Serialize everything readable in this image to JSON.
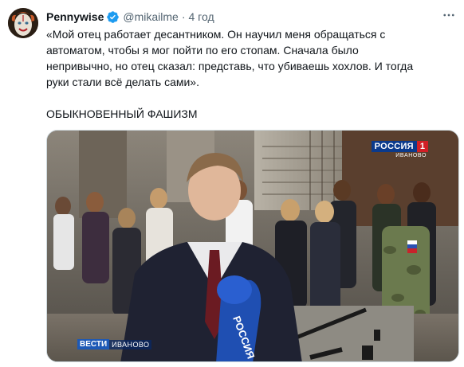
{
  "tweet": {
    "author": {
      "display_name": "Pennywise",
      "handle": "@mikailme",
      "verified": true,
      "avatar_icon": "clown-avatar"
    },
    "separator": "·",
    "timestamp": "4 год",
    "more_icon": "more-horizontal-icon",
    "text_lines": [
      "«Мой отец работает десантником. Он научил меня обращаться с",
      "автоматом, чтобы я мог пойти по его стопам. Сначала было",
      "непривычно, но отец сказал: представь, что убиваешь хохлов. И тогда",
      "руки стали всё делать сами»."
    ],
    "caption_line": "ОБЫКНОВЕННЫЙ ФАШИЗМ",
    "media": {
      "channel_logo": "РОССИЯ",
      "channel_number": "1",
      "channel_region": "ИВАНОВО",
      "program_brand": "ВЕСТИ",
      "program_region": "ИВАНОВО"
    }
  },
  "colors": {
    "text_primary": "#0f1419",
    "text_secondary": "#536471",
    "verified_blue": "#1d9bf0",
    "border": "#cfd9de"
  }
}
